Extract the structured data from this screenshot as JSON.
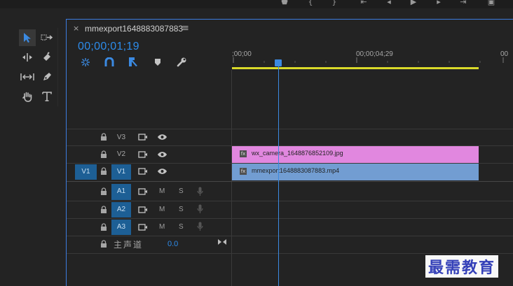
{
  "sequence": {
    "name": "mmexport1648883087883",
    "close_glyph": "×",
    "menu_glyph": "≡",
    "timecode": "00;00;01;19"
  },
  "ruler": {
    "labels": [
      ";00;00",
      "00;00;04;29",
      "00"
    ]
  },
  "video_tracks": [
    {
      "name": "V3"
    },
    {
      "name": "V2"
    },
    {
      "name": "V1",
      "source_patch": "V1"
    }
  ],
  "audio_tracks": [
    {
      "name": "A1",
      "mute": "M",
      "solo": "S"
    },
    {
      "name": "A2",
      "mute": "M",
      "solo": "S"
    },
    {
      "name": "A3",
      "mute": "M",
      "solo": "S"
    }
  ],
  "master": {
    "label": "主声道",
    "value": "0.0"
  },
  "clips": [
    {
      "track": "V2",
      "name": "wx_camera_1648876852109.jpg",
      "color": "#e187df"
    },
    {
      "track": "V1",
      "name": "mmexport1648883087883.mp4",
      "color": "#729dd2"
    }
  ],
  "toolbar_tools": [
    "selection-tool",
    "track-select-forward-tool",
    "ripple-edit-tool",
    "razor-tool",
    "slip-tool",
    "pen-tool",
    "hand-tool",
    "type-tool"
  ],
  "timeline_icons": [
    "nest-icon",
    "snap-icon",
    "linked-selection-icon",
    "add-marker-icon",
    "wrench-icon"
  ],
  "watermark": "最需教育",
  "colors": {
    "accent": "#2d8ceb",
    "playhead": "#3b8ae2",
    "work_area": "#dada2a",
    "track_target": "#1d5f95"
  }
}
